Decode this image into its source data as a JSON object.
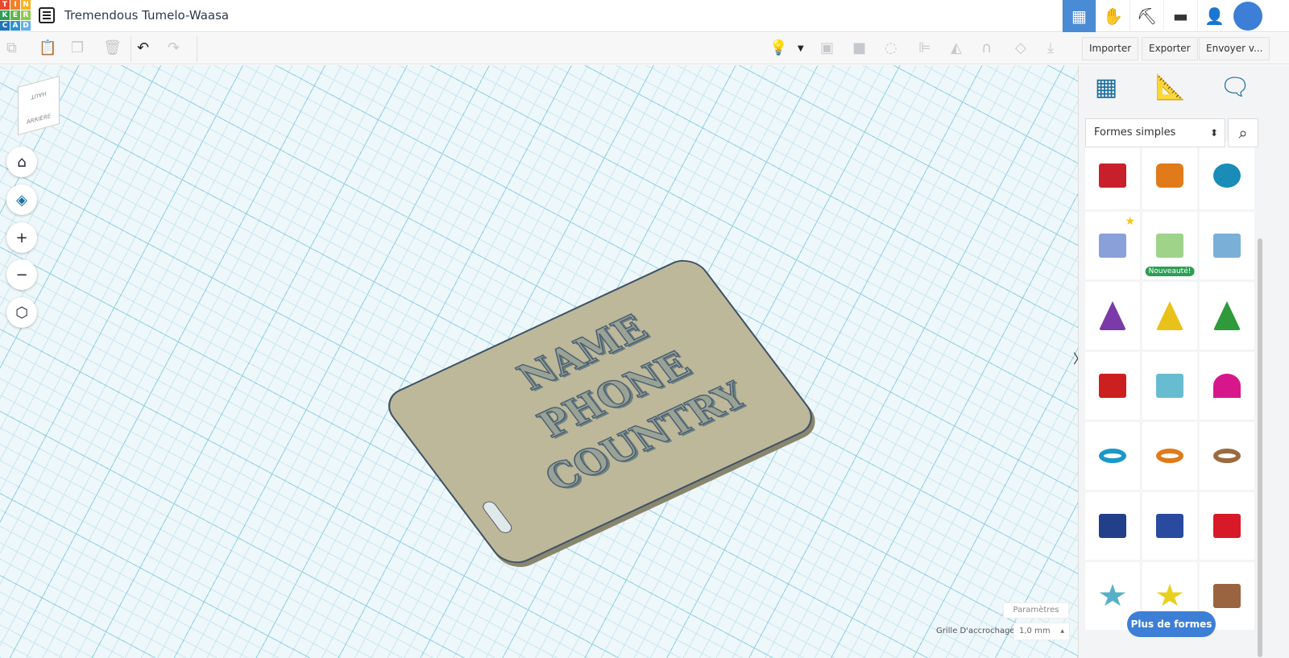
{
  "app": {
    "logo_letters": [
      "T",
      "I",
      "N",
      "K",
      "E",
      "R",
      "C",
      "A",
      "D"
    ],
    "logo_colors": [
      "#e8492c",
      "#f0802a",
      "#f5b325",
      "#2f9d54",
      "#5fb843",
      "#8ccb4c",
      "#1f74b8",
      "#2c91d1",
      "#62b3e3"
    ],
    "title": "Tremendous Tumelo-Waasa"
  },
  "topbar": {
    "icons": [
      "grid-view-icon",
      "blocks-icon",
      "minecraft-pickaxe-icon",
      "lego-brick-icon",
      "add-user-icon",
      "avatar-icon"
    ],
    "accent": "#4a8bd6"
  },
  "toolbar": {
    "import": "Importer",
    "export": "Exporter",
    "send": "Envoyer v..."
  },
  "viewport": {
    "viewcube_top": "HAUT",
    "viewcube_front": "ARRIÈRE",
    "object_text": [
      "NAME",
      "PHONE",
      "COUNTRY"
    ],
    "settings": "Paramètres",
    "snap_label": "Grille D'accrochage",
    "snap_value": "1,0 mm"
  },
  "sidebar": {
    "category": "Formes simples",
    "new_badge": "Nouveauté!",
    "more_button": "Plus de formes",
    "shapes": [
      {
        "name": "box",
        "color": "#c8202a"
      },
      {
        "name": "cylinder",
        "color": "#e07a1a"
      },
      {
        "name": "sphere",
        "color": "#1a8cb8"
      },
      {
        "name": "scribble",
        "color": "#8aa0d8"
      },
      {
        "name": "spinning-top",
        "color": "#9fd38a"
      },
      {
        "name": "text-3d",
        "color": "#7ab0d8"
      },
      {
        "name": "cone",
        "color": "#7a3aa8"
      },
      {
        "name": "pyramid",
        "color": "#e8c218"
      },
      {
        "name": "roof",
        "color": "#2e9a3a"
      },
      {
        "name": "text",
        "color": "#cc2020"
      },
      {
        "name": "half-cylinder",
        "color": "#68bcd0"
      },
      {
        "name": "half-sphere",
        "color": "#d8168c"
      },
      {
        "name": "torus",
        "color": "#1a98c8"
      },
      {
        "name": "tube",
        "color": "#e07a1a"
      },
      {
        "name": "ring",
        "color": "#9a6a40"
      },
      {
        "name": "wedge-box",
        "color": "#223f8a"
      },
      {
        "name": "hexagonal-prism",
        "color": "#2a4aa0"
      },
      {
        "name": "polyhedron",
        "color": "#d81a28"
      },
      {
        "name": "star-teal",
        "color": "#58b0c8"
      },
      {
        "name": "star-yellow",
        "color": "#e8d020"
      },
      {
        "name": "heart",
        "color": "#9a6440"
      }
    ]
  }
}
